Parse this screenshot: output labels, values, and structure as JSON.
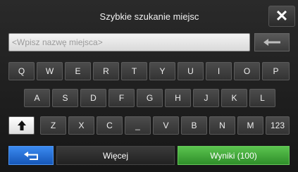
{
  "header": {
    "title": "Szybkie szukanie miejsc",
    "close_label": "✕"
  },
  "search": {
    "placeholder": "<Wpisz nazwę miejsca>",
    "value": ""
  },
  "keyboard": {
    "row1": [
      "Q",
      "W",
      "E",
      "R",
      "T",
      "Y",
      "U",
      "I",
      "O",
      "P"
    ],
    "row2": [
      "A",
      "S",
      "D",
      "F",
      "G",
      "H",
      "J",
      "K",
      "L"
    ],
    "row3": [
      "Z",
      "X",
      "C",
      "_",
      "V",
      "B",
      "N",
      "M"
    ],
    "shift_icon": "shift-arrow-up-icon",
    "numeric_label": "123"
  },
  "footer": {
    "more_label": "Więcej",
    "results_label": "Wyniki (100)"
  },
  "colors": {
    "accent_blue": "#1e6fd9",
    "results_green": "#3fa83a"
  }
}
